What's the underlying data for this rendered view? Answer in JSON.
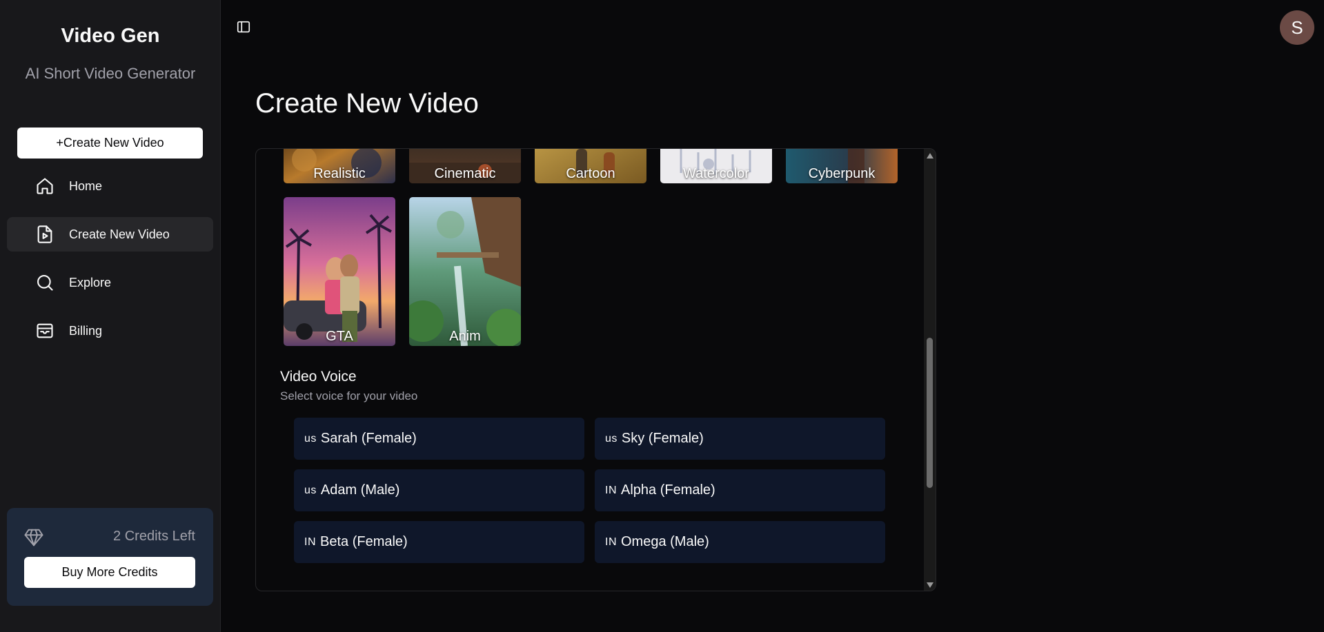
{
  "sidebar": {
    "brand": "Video Gen",
    "tagline": "AI Short Video Generator",
    "create_button": "+Create New Video",
    "nav": [
      {
        "label": "Home",
        "icon": "home-icon"
      },
      {
        "label": "Create New Video",
        "icon": "file-video-icon",
        "active": true
      },
      {
        "label": "Explore",
        "icon": "search-icon"
      },
      {
        "label": "Billing",
        "icon": "inbox-icon"
      }
    ],
    "credits": {
      "text": "2 Credits Left",
      "icon": "gem-icon",
      "buy_button": "Buy More Credits"
    }
  },
  "header": {
    "avatar_initial": "S",
    "toggle_icon": "panel-left-icon"
  },
  "main": {
    "title": "Create New Video",
    "styles": [
      {
        "label": "Realistic"
      },
      {
        "label": "Cinematic"
      },
      {
        "label": "Cartoon"
      },
      {
        "label": "Watercolor"
      },
      {
        "label": "Cyberpunk"
      },
      {
        "label": "GTA"
      },
      {
        "label": "Anim"
      }
    ],
    "voice_section": {
      "title": "Video Voice",
      "subtitle": "Select voice for your video",
      "voices": [
        {
          "flag": "us",
          "label": "Sarah (Female)"
        },
        {
          "flag": "us",
          "label": "Sky (Female)"
        },
        {
          "flag": "us",
          "label": "Adam (Male)"
        },
        {
          "flag": "IN",
          "label": "Alpha (Female)"
        },
        {
          "flag": "IN",
          "label": "Beta (Female)"
        },
        {
          "flag": "IN",
          "label": "Omega (Male)"
        }
      ]
    }
  },
  "colors": {
    "background": "#09090b",
    "sidebar": "#18181b",
    "active_nav": "#27272a",
    "voice_card": "#0f172a",
    "credits_box": "#1e293b",
    "avatar": "#6b4a45"
  }
}
